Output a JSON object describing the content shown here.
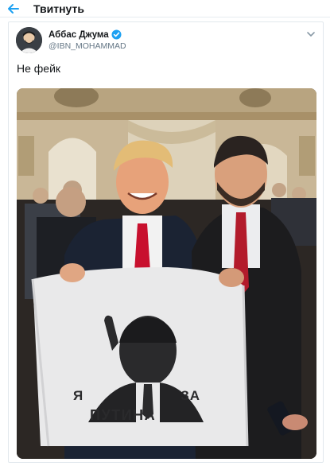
{
  "header": {
    "title": "Твитнуть"
  },
  "tweet": {
    "display_name": "Аббас Джума",
    "handle": "@IBN_MOHAMMAD",
    "text": "Не фейк",
    "photo": {
      "sweater_text_line1_left": "Я",
      "sweater_text_line1_right": "ЗА",
      "sweater_text_line2": "ПУТИНА"
    }
  },
  "colors": {
    "accent": "#1da1f2",
    "text": "#14171a",
    "secondary_text": "#657786"
  }
}
